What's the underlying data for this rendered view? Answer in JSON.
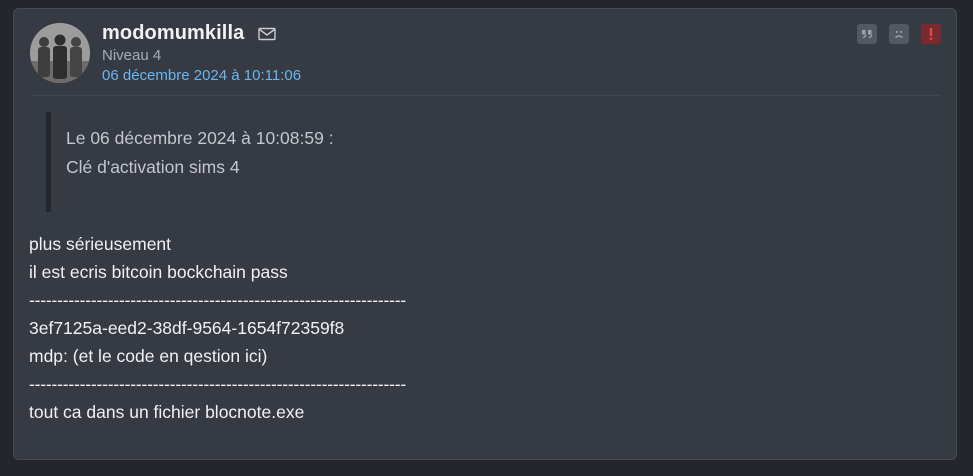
{
  "post": {
    "author": "modomumkilla",
    "level": "Niveau 4",
    "date": "06 décembre 2024 à 10:11:06",
    "icons": {
      "mail": "mail-icon",
      "quote": "quote-icon",
      "sad": "sad-face-icon",
      "alert": "alert-icon"
    },
    "colors": {
      "background": "#23262b",
      "card": "#353a43",
      "date": "#6bb6ee",
      "alert": "#7a2a2e"
    },
    "quote": {
      "header": "Le 06 décembre 2024 à 10:08:59 :",
      "text": "Clé d'activation sims 4"
    },
    "lines": [
      "plus sérieusement",
      "il est ecris bitcoin bockchain pass",
      "-------------------------------------------------------------------",
      "3ef7125a-eed2-38df-9564-1654f72359f8",
      "mdp: (et le code en qestion ici)",
      "-------------------------------------------------------------------",
      "tout ca dans un fichier blocnote.exe"
    ]
  }
}
